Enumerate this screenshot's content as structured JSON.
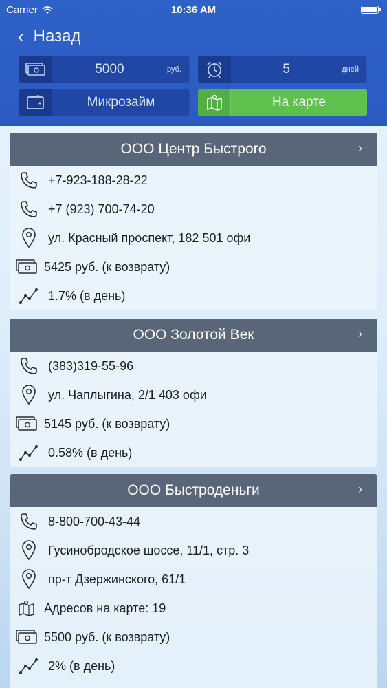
{
  "status_bar": {
    "carrier": "Carrier",
    "time": "10:36 AM"
  },
  "nav": {
    "back_label": "Назад"
  },
  "filters": {
    "amount": {
      "value": "5000",
      "unit": "руб."
    },
    "term": {
      "value": "5",
      "unit": "дней"
    },
    "loan_type": {
      "label": "Микрозайм"
    },
    "map_button": {
      "label": "На карте"
    }
  },
  "colors": {
    "header": "#2f62c8",
    "tile": "#2147a6",
    "map_button": "#5ec14e",
    "card_header": "#59667a"
  },
  "companies": [
    {
      "name": "ООО Центр Быстрого",
      "phones": [
        "+7-923-188-28-22",
        "+7 (923) 700-74-20"
      ],
      "addresses": [
        "ул. Красный проспект, 182 501 офи"
      ],
      "return_amount": "5425 руб. (к возврату)",
      "rate": "1.7% (в день)"
    },
    {
      "name": "ООО Золотой Век",
      "phones": [
        "(383)319-55-96"
      ],
      "addresses": [
        "ул. Чаплыгина, 2/1 403 офи"
      ],
      "return_amount": "5145 руб. (к возврату)",
      "rate": "0.58% (в день)"
    },
    {
      "name": "ООО Быстроденьги",
      "phones": [
        "8-800-700-43-44"
      ],
      "addresses": [
        "Гусинобродское шоссе, 11/1, стр. 3",
        "пр-т Дзержинского, 61/1"
      ],
      "map_addresses": "Адресов на карте: 19",
      "return_amount": "5500 руб. (к возврату)",
      "rate": "2% (в день)"
    }
  ]
}
